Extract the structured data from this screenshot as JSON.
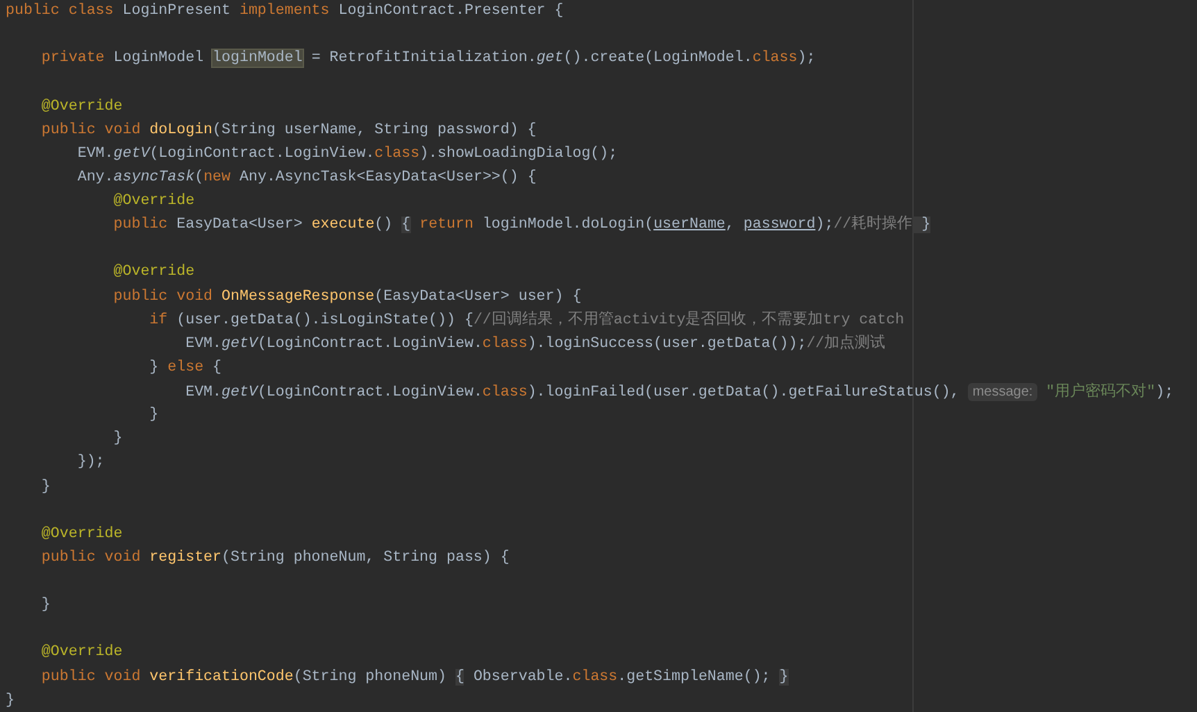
{
  "editor": {
    "lines": [
      {
        "kind": "code",
        "tokens": [
          {
            "kind": "kw",
            "text": "public class "
          },
          {
            "kind": "plain",
            "text": "LoginPresent "
          },
          {
            "kind": "kw",
            "text": "implements "
          },
          {
            "kind": "plain",
            "text": "LoginContract.Presenter {"
          }
        ]
      },
      {
        "kind": "blank"
      },
      {
        "kind": "code",
        "tokens": [
          {
            "kind": "kw",
            "text": "    private "
          },
          {
            "kind": "plain",
            "text": "LoginModel "
          },
          {
            "kind": "hl",
            "text": "loginModel"
          },
          {
            "kind": "plain",
            "text": " = RetrofitInitialization."
          },
          {
            "kind": "ital",
            "text": "get"
          },
          {
            "kind": "plain",
            "text": "().create(LoginModel."
          },
          {
            "kind": "kw",
            "text": "class"
          },
          {
            "kind": "plain",
            "text": ");"
          }
        ]
      },
      {
        "kind": "blank"
      },
      {
        "kind": "code",
        "tokens": [
          {
            "kind": "ann",
            "text": "    @Override"
          }
        ]
      },
      {
        "kind": "code",
        "tokens": [
          {
            "kind": "kw",
            "text": "    public void "
          },
          {
            "kind": "decl",
            "text": "doLogin"
          },
          {
            "kind": "plain",
            "text": "(String userName, String password) {"
          }
        ]
      },
      {
        "kind": "code",
        "tokens": [
          {
            "kind": "plain",
            "text": "        EVM."
          },
          {
            "kind": "ital",
            "text": "getV"
          },
          {
            "kind": "plain",
            "text": "(LoginContract.LoginView."
          },
          {
            "kind": "kw",
            "text": "class"
          },
          {
            "kind": "plain",
            "text": ").showLoadingDialog();"
          }
        ]
      },
      {
        "kind": "code",
        "tokens": [
          {
            "kind": "plain",
            "text": "        Any."
          },
          {
            "kind": "ital",
            "text": "asyncTask"
          },
          {
            "kind": "plain",
            "text": "("
          },
          {
            "kind": "kw",
            "text": "new "
          },
          {
            "kind": "plain",
            "text": "Any.AsyncTask<EasyData<User>>() {"
          }
        ]
      },
      {
        "kind": "code",
        "tokens": [
          {
            "kind": "ann",
            "text": "            @Override"
          }
        ]
      },
      {
        "kind": "code",
        "tokens": [
          {
            "kind": "kw",
            "text": "            public "
          },
          {
            "kind": "plain",
            "text": "EasyData<User> "
          },
          {
            "kind": "decl",
            "text": "execute"
          },
          {
            "kind": "plain",
            "text": "() "
          },
          {
            "kind": "fold",
            "text": "{"
          },
          {
            "kind": "kw",
            "text": " return "
          },
          {
            "kind": "plain",
            "text": "loginModel.doLogin("
          },
          {
            "kind": "ul",
            "text": "userName"
          },
          {
            "kind": "plain",
            "text": ", "
          },
          {
            "kind": "ul",
            "text": "password"
          },
          {
            "kind": "plain",
            "text": ");"
          },
          {
            "kind": "cmt",
            "text": "//耗时操作"
          },
          {
            "kind": "fold",
            "text": " }"
          }
        ]
      },
      {
        "kind": "blank"
      },
      {
        "kind": "code",
        "tokens": [
          {
            "kind": "ann",
            "text": "            @Override"
          }
        ]
      },
      {
        "kind": "code",
        "tokens": [
          {
            "kind": "kw",
            "text": "            public void "
          },
          {
            "kind": "decl",
            "text": "OnMessageResponse"
          },
          {
            "kind": "plain",
            "text": "(EasyData<User> user) {"
          }
        ]
      },
      {
        "kind": "code",
        "tokens": [
          {
            "kind": "kw",
            "text": "                if "
          },
          {
            "kind": "plain",
            "text": "(user.getData().isLoginState()) {"
          },
          {
            "kind": "cmt",
            "text": "//回调结果，不用管activity是否回收，不需要加try catch"
          }
        ]
      },
      {
        "kind": "code",
        "tokens": [
          {
            "kind": "plain",
            "text": "                    EVM."
          },
          {
            "kind": "ital",
            "text": "getV"
          },
          {
            "kind": "plain",
            "text": "(LoginContract.LoginView."
          },
          {
            "kind": "kw",
            "text": "class"
          },
          {
            "kind": "plain",
            "text": ").loginSuccess(user.getData());"
          },
          {
            "kind": "cmt",
            "text": "//加点测试"
          }
        ]
      },
      {
        "kind": "code",
        "tokens": [
          {
            "kind": "plain",
            "text": "                } "
          },
          {
            "kind": "kw",
            "text": "else "
          },
          {
            "kind": "plain",
            "text": "{"
          }
        ]
      },
      {
        "kind": "code",
        "tokens": [
          {
            "kind": "plain",
            "text": "                    EVM."
          },
          {
            "kind": "ital",
            "text": "getV"
          },
          {
            "kind": "plain",
            "text": "(LoginContract.LoginView."
          },
          {
            "kind": "kw",
            "text": "class"
          },
          {
            "kind": "plain",
            "text": ").loginFailed(user.getData().getFailureStatus(), "
          },
          {
            "kind": "hint",
            "text": "message:"
          },
          {
            "kind": "str",
            "text": " \"用户密码不对\""
          },
          {
            "kind": "plain",
            "text": ");"
          }
        ]
      },
      {
        "kind": "code",
        "tokens": [
          {
            "kind": "plain",
            "text": "                }"
          }
        ]
      },
      {
        "kind": "code",
        "tokens": [
          {
            "kind": "plain",
            "text": "            }"
          }
        ]
      },
      {
        "kind": "code",
        "tokens": [
          {
            "kind": "plain",
            "text": "        });"
          }
        ]
      },
      {
        "kind": "code",
        "tokens": [
          {
            "kind": "plain",
            "text": "    }"
          }
        ]
      },
      {
        "kind": "blank"
      },
      {
        "kind": "code",
        "tokens": [
          {
            "kind": "ann",
            "text": "    @Override"
          }
        ]
      },
      {
        "kind": "code",
        "tokens": [
          {
            "kind": "kw",
            "text": "    public void "
          },
          {
            "kind": "decl",
            "text": "register"
          },
          {
            "kind": "plain",
            "text": "(String phoneNum, String pass) {"
          }
        ]
      },
      {
        "kind": "blank"
      },
      {
        "kind": "code",
        "tokens": [
          {
            "kind": "plain",
            "text": "    }"
          }
        ]
      },
      {
        "kind": "blank"
      },
      {
        "kind": "code",
        "tokens": [
          {
            "kind": "ann",
            "text": "    @Override"
          }
        ]
      },
      {
        "kind": "code",
        "tokens": [
          {
            "kind": "kw",
            "text": "    public void "
          },
          {
            "kind": "decl",
            "text": "verificationCode"
          },
          {
            "kind": "plain",
            "text": "(String phoneNum) "
          },
          {
            "kind": "fold",
            "text": "{"
          },
          {
            "kind": "plain",
            "text": " Observable."
          },
          {
            "kind": "kw",
            "text": "class"
          },
          {
            "kind": "plain",
            "text": ".getSimpleName(); "
          },
          {
            "kind": "fold",
            "text": "}"
          }
        ]
      },
      {
        "kind": "code",
        "tokens": [
          {
            "kind": "plain",
            "text": "}"
          }
        ]
      }
    ]
  }
}
